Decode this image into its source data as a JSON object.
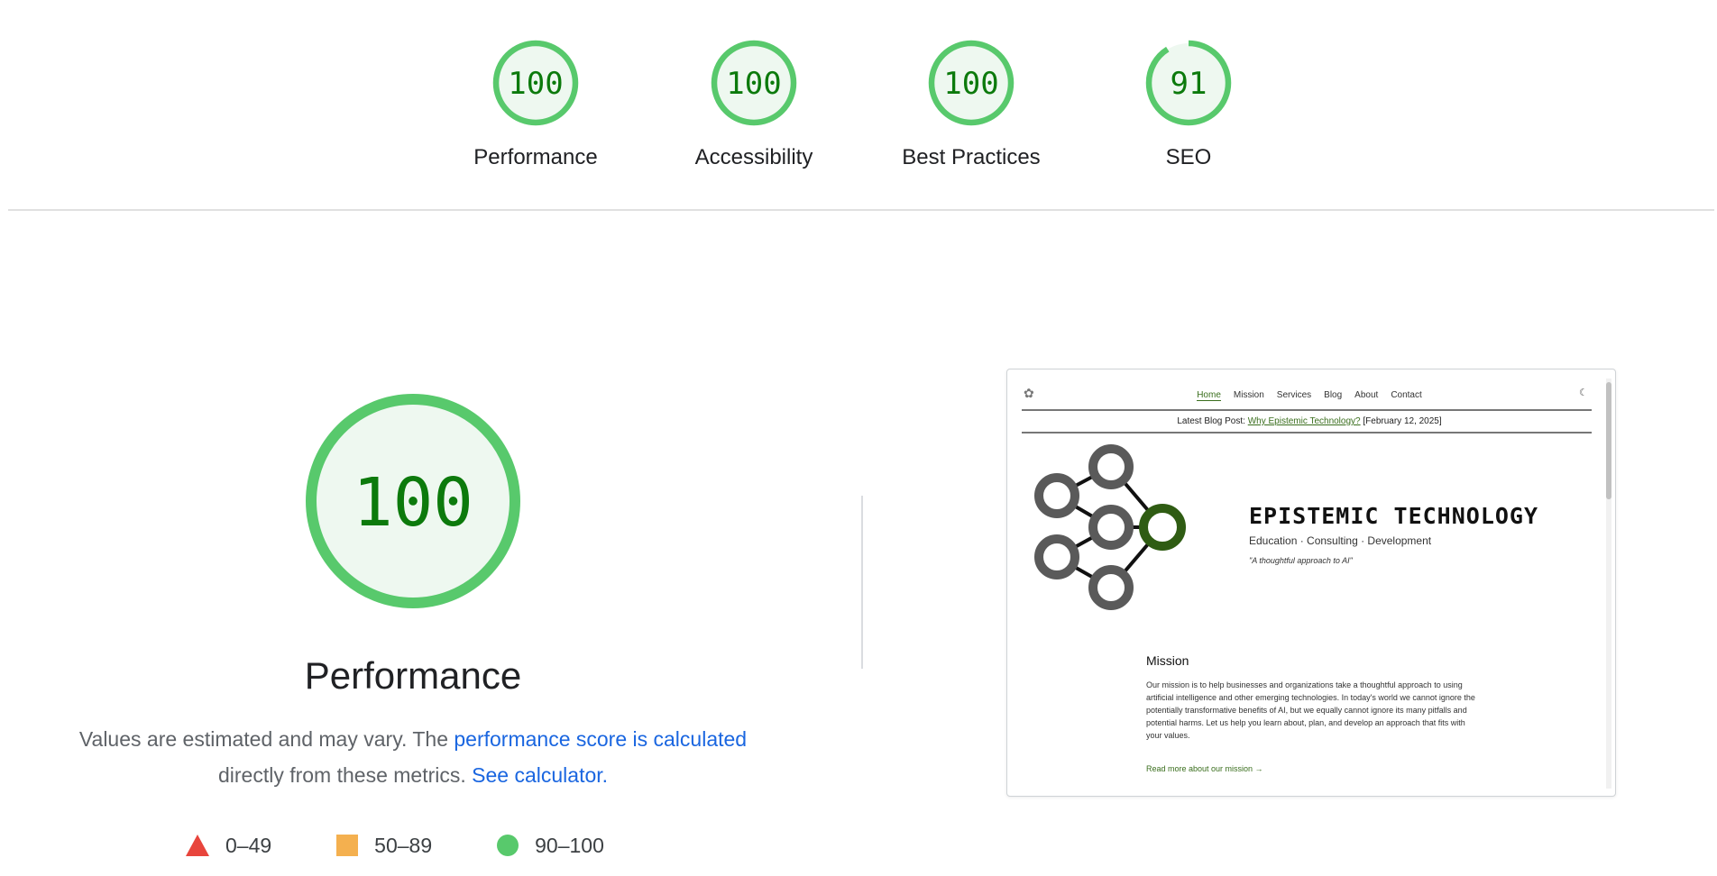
{
  "categories": [
    {
      "label": "Performance",
      "score": "100",
      "value": 100
    },
    {
      "label": "Accessibility",
      "score": "100",
      "value": 100
    },
    {
      "label": "Best Practices",
      "score": "100",
      "value": 100
    },
    {
      "label": "SEO",
      "score": "91",
      "value": 91
    }
  ],
  "main": {
    "score": "100",
    "value": 100,
    "title": "Performance",
    "desc_prefix": "Values are estimated and may vary. The ",
    "desc_link": "performance score is calculated",
    "desc_middle": " directly from these metrics. ",
    "desc_calc_link": "See calculator."
  },
  "legend": [
    {
      "shape": "triangle",
      "label": "0–49",
      "color": "#e8453c"
    },
    {
      "shape": "square",
      "label": "50–89",
      "color": "#f4b04f"
    },
    {
      "shape": "circle",
      "label": "90–100",
      "color": "#58c96c"
    }
  ],
  "colors": {
    "pass": "#58c96c",
    "pass_fill": "#eef8f0",
    "pass_text": "#0c7a0c",
    "link": "#1a66e0"
  },
  "thumbnail": {
    "logo_icon": "network-logo-icon",
    "nav": [
      "Home",
      "Mission",
      "Services",
      "Blog",
      "About",
      "Contact"
    ],
    "nav_active": "Home",
    "theme_icon": "moon-icon",
    "banner_prefix": "Latest Blog Post: ",
    "banner_link": "Why Epistemic Technology?",
    "banner_date": " [February 12, 2025]",
    "title": "EPISTEMIC TECHNOLOGY",
    "subtitle": "Education · Consulting · Development",
    "tagline": "\"A thoughtful approach to AI\"",
    "mission_heading": "Mission",
    "mission_text": "Our mission is to help businesses and organizations take a thoughtful approach to using artificial intelligence and other emerging technologies. In today's world we cannot ignore the potentially transformative benefits of AI, but we equally cannot ignore its many pitfalls and potential harms. Let us help you learn about, plan, and develop an approach that fits with your values.",
    "read_more": "Read more about our mission →"
  }
}
